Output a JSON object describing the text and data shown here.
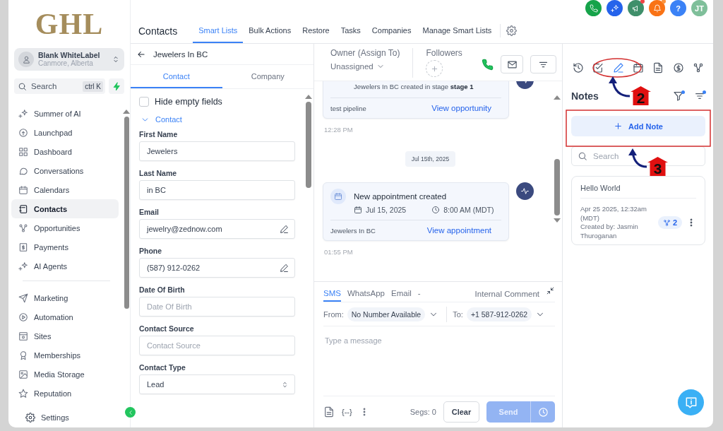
{
  "sidebar": {
    "logo": "GHL",
    "account": {
      "name": "Blank WhiteLabel",
      "location": "Canmore, Alberta"
    },
    "search": {
      "placeholder": "Search",
      "shortcut": "ctrl K"
    },
    "nav_groups": [
      [
        {
          "label": "Summer of AI",
          "selected": false
        },
        {
          "label": "Launchpad",
          "selected": false
        },
        {
          "label": "Dashboard",
          "selected": false
        },
        {
          "label": "Conversations",
          "selected": false
        },
        {
          "label": "Calendars",
          "selected": false
        },
        {
          "label": "Contacts",
          "selected": true
        },
        {
          "label": "Opportunities",
          "selected": false
        },
        {
          "label": "Payments",
          "selected": false
        },
        {
          "label": "AI Agents",
          "selected": false
        }
      ],
      [
        {
          "label": "Marketing",
          "selected": false
        },
        {
          "label": "Automation",
          "selected": false
        },
        {
          "label": "Sites",
          "selected": false
        },
        {
          "label": "Memberships",
          "selected": false
        },
        {
          "label": "Media Storage",
          "selected": false
        },
        {
          "label": "Reputation",
          "selected": false
        }
      ]
    ],
    "settings": "Settings"
  },
  "header": {
    "title": "Contacts",
    "tabs": [
      {
        "label": "Smart Lists",
        "selected": true
      },
      {
        "label": "Bulk Actions",
        "selected": false
      },
      {
        "label": "Restore",
        "selected": false
      },
      {
        "label": "Tasks",
        "selected": false
      },
      {
        "label": "Companies",
        "selected": false
      },
      {
        "label": "Manage Smart Lists",
        "selected": false
      }
    ],
    "help": "?",
    "avatar": "JT"
  },
  "contact_panel": {
    "title": "Jewelers In BC",
    "tabs": [
      {
        "label": "Contact",
        "selected": true
      },
      {
        "label": "Company",
        "selected": false
      }
    ],
    "hide_empty": {
      "label": "Hide empty fields",
      "checked": false
    },
    "section": {
      "label": "Contact",
      "expanded": true
    },
    "fields": [
      {
        "kind": "text",
        "label": "First Name",
        "value": "Jewelers"
      },
      {
        "kind": "text",
        "label": "Last Name",
        "value": "in BC"
      },
      {
        "kind": "editable",
        "label": "Email",
        "value": "jewelry@zednow.com"
      },
      {
        "kind": "editable",
        "label": "Phone",
        "value": "(587) 912-0262"
      },
      {
        "kind": "text",
        "label": "Date Of Birth",
        "placeholder": "Date Of Birth"
      },
      {
        "kind": "text",
        "label": "Contact Source",
        "placeholder": "Contact Source"
      },
      {
        "kind": "select",
        "label": "Contact Type",
        "value": "Lead"
      }
    ]
  },
  "timeline_panel": {
    "owner": {
      "label": "Owner (Assign To)",
      "value": "Unassigned"
    },
    "followers": {
      "label": "Followers"
    },
    "events": [
      {
        "kind": "opportunity",
        "subtitle": "Jewelers In BC created in stage **stage 1**",
        "footer": "test pipeline",
        "link": "View opportunity",
        "time": "12:28 PM"
      },
      {
        "kind": "date",
        "label": "Jul 15th, 2025"
      },
      {
        "kind": "appointment",
        "title": "New appointment created",
        "date": "Jul 15, 2025",
        "clock": "8:00 AM (MDT)",
        "footer": "Jewelers In BC",
        "link": "View appointment",
        "time": "01:55 PM"
      }
    ]
  },
  "composer": {
    "channels": [
      {
        "label": "SMS",
        "selected": true
      },
      {
        "label": "WhatsApp",
        "selected": false
      },
      {
        "label": "Email",
        "selected": false
      },
      {
        "label": "-",
        "selected": false
      }
    ],
    "internal": "Internal Comment",
    "from": {
      "label": "From:",
      "value": "No Number Available"
    },
    "to": {
      "label": "To:",
      "value": "+1 587-912-0262"
    },
    "message": {
      "placeholder": "Type a message"
    },
    "variables": "{--}",
    "segments": "Segs: 0",
    "clear": "Clear",
    "send": {
      "label": "Send",
      "disabled": true
    }
  },
  "notes_panel": {
    "tabs": [
      {
        "selected": false
      },
      {
        "selected": false
      },
      {
        "selected": true
      },
      {
        "selected": false
      },
      {
        "selected": false
      },
      {
        "selected": false
      },
      {
        "selected": false
      }
    ],
    "title": "Notes",
    "add_button": "Add Note",
    "search": {
      "placeholder": "Search"
    },
    "notes": [
      {
        "title": "Hello World",
        "date": "Apr 25 2025, 12:32am (MDT)",
        "author": "Created by: Jasmin Thuroganan",
        "links": "2"
      }
    ]
  },
  "annotations": [
    {
      "label": "2"
    },
    {
      "label": "3"
    }
  ]
}
